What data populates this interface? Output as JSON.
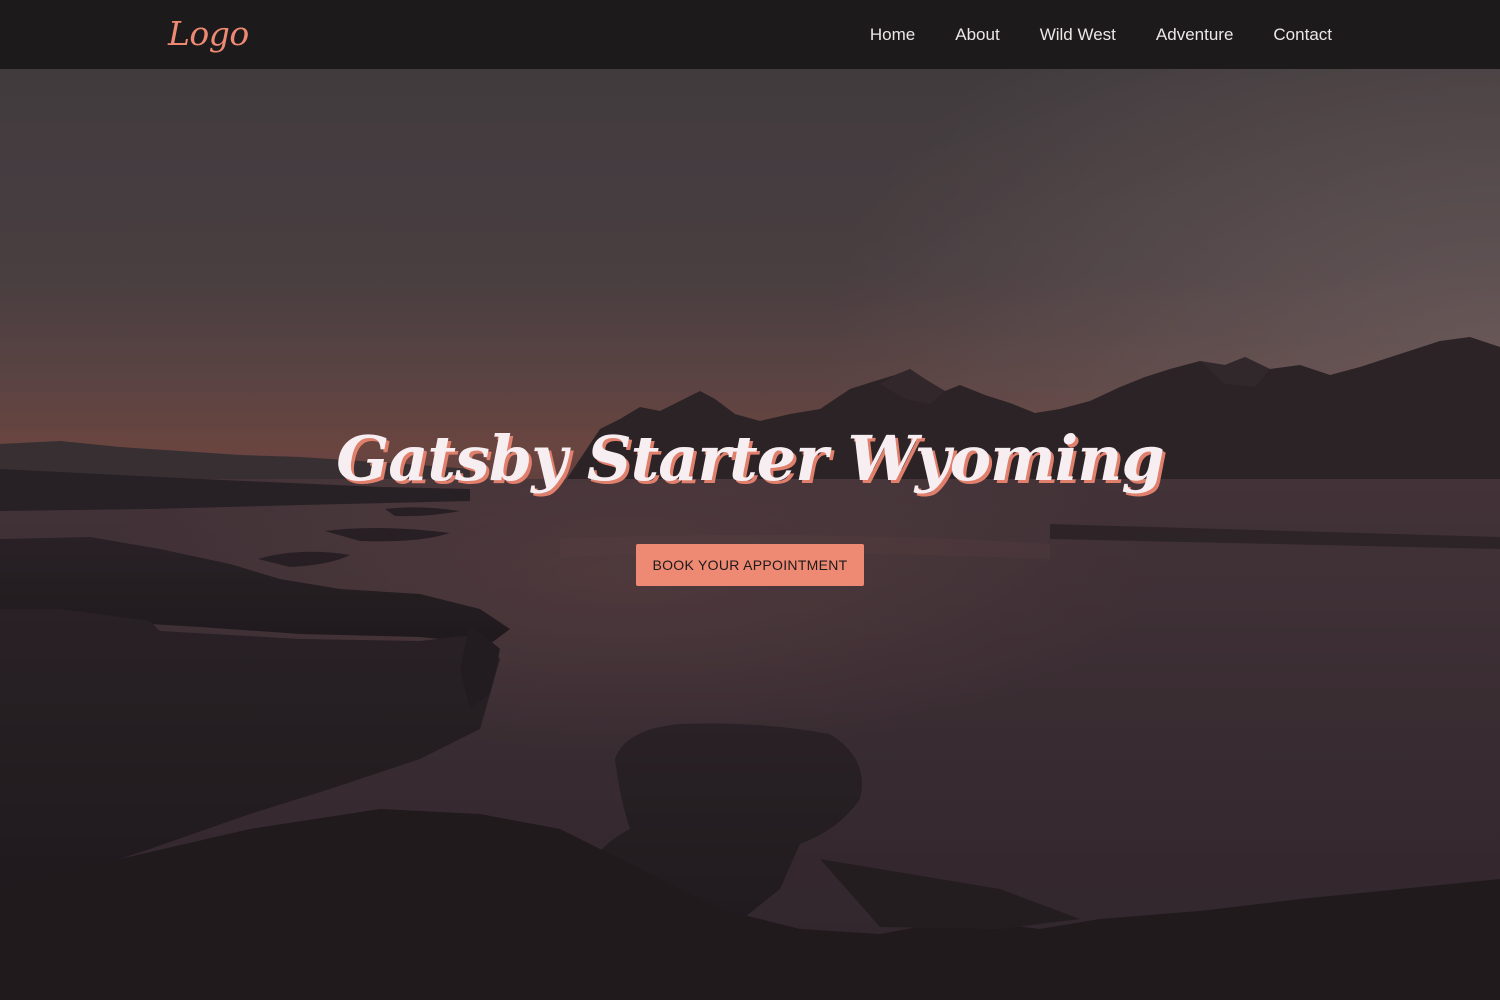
{
  "header": {
    "logo": "Logo",
    "nav": [
      {
        "label": "Home"
      },
      {
        "label": "About"
      },
      {
        "label": "Wild West"
      },
      {
        "label": "Adventure"
      },
      {
        "label": "Contact"
      }
    ]
  },
  "hero": {
    "title": "Gatsby Starter Wyoming",
    "cta_label": "BOOK YOUR APPOINTMENT",
    "background_image": "dusk-mountain-lake"
  },
  "colors": {
    "header_bg": "#1d1a1c",
    "accent": "#ee8a73",
    "nav_text": "#ece7e7",
    "title_text": "#f7eef2"
  }
}
